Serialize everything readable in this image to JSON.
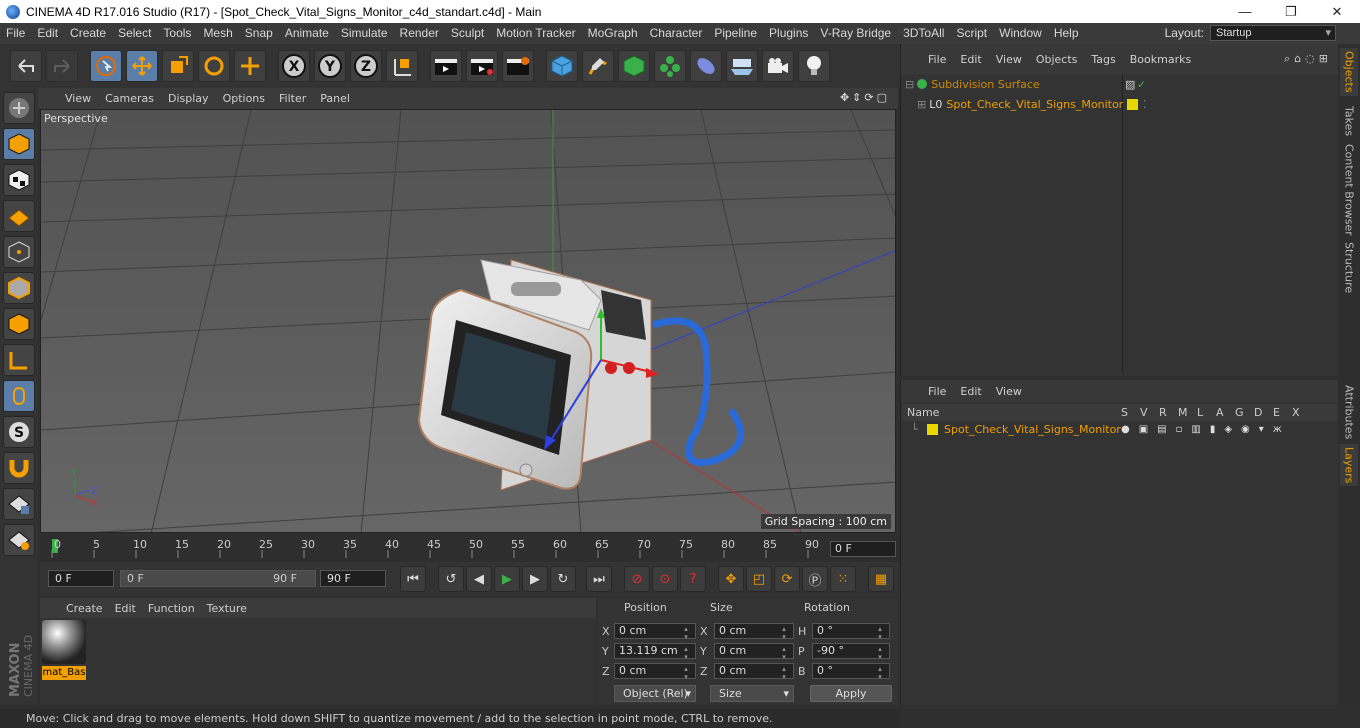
{
  "window": {
    "title": "CINEMA 4D R17.016 Studio (R17) - [Spot_Check_Vital_Signs_Monitor_c4d_standart.c4d] - Main",
    "minimize": "—",
    "maximize": "❐",
    "close": "✕"
  },
  "menubar": {
    "items": [
      "File",
      "Edit",
      "Create",
      "Select",
      "Tools",
      "Mesh",
      "Snap",
      "Animate",
      "Simulate",
      "Render",
      "Sculpt",
      "Motion Tracker",
      "MoGraph",
      "Character",
      "Pipeline",
      "Plugins",
      "V-Ray Bridge",
      "3DToAll",
      "Script",
      "Window",
      "Help"
    ],
    "layout_label": "Layout:",
    "layout_value": "Startup"
  },
  "viewport": {
    "menu": [
      "View",
      "Cameras",
      "Display",
      "Options",
      "Filter",
      "Panel"
    ],
    "camera_label": "Perspective",
    "grid_spacing": "Grid Spacing : 100 cm"
  },
  "timeline": {
    "ticks": [
      "0",
      "5",
      "10",
      "15",
      "20",
      "25",
      "30",
      "35",
      "40",
      "45",
      "50",
      "55",
      "60",
      "65",
      "70",
      "75",
      "80",
      "85",
      "90"
    ],
    "end_field": "0 F"
  },
  "transport": {
    "current_frame": "0 F",
    "range_start": "0 F",
    "range_end_inline": "90 F",
    "range_end": "90 F"
  },
  "material_panel": {
    "menu": [
      "Create",
      "Edit",
      "Function",
      "Texture"
    ],
    "material_name": "mat_Bas"
  },
  "attributes": {
    "headers": [
      "Position",
      "Size",
      "Rotation"
    ],
    "rows": [
      {
        "axis": "X",
        "pos": "0 cm",
        "size_axis": "X",
        "size": "0 cm",
        "rot_axis": "H",
        "rot": "0 °"
      },
      {
        "axis": "Y",
        "pos": "13.119 cm",
        "size_axis": "Y",
        "size": "0 cm",
        "rot_axis": "P",
        "rot": "-90 °"
      },
      {
        "axis": "Z",
        "pos": "0 cm",
        "size_axis": "Z",
        "size": "0 cm",
        "rot_axis": "B",
        "rot": "0 °"
      }
    ],
    "coord_mode": "Object (Rel)",
    "size_mode": "Size",
    "apply": "Apply"
  },
  "status": {
    "text": "Move: Click and drag to move elements. Hold down SHIFT to quantize movement / add to the selection in point mode, CTRL to remove."
  },
  "object_manager": {
    "menu": [
      "File",
      "Edit",
      "View",
      "Objects",
      "Tags",
      "Bookmarks"
    ],
    "objects": [
      "Subdivision Surface",
      "Spot_Check_Vital_Signs_Monitor"
    ]
  },
  "layer_manager": {
    "menu": [
      "File",
      "Edit",
      "View"
    ],
    "header_name": "Name",
    "header_cols": [
      "S",
      "V",
      "R",
      "M",
      "L",
      "A",
      "G",
      "D",
      "E",
      "X"
    ],
    "layer_name": "Spot_Check_Vital_Signs_Monitor"
  },
  "side_tabs": [
    "Objects",
    "Takes",
    "Content Browser",
    "Structure",
    "Attributes",
    "Layers"
  ],
  "colors": {
    "accent_orange": "#f0a000",
    "active_blue": "#5a7ea8",
    "viewport_bg": "#595959",
    "layer_yellow": "#e8d800"
  },
  "brand": {
    "vendor": "MAXON",
    "product": "CINEMA 4D"
  }
}
